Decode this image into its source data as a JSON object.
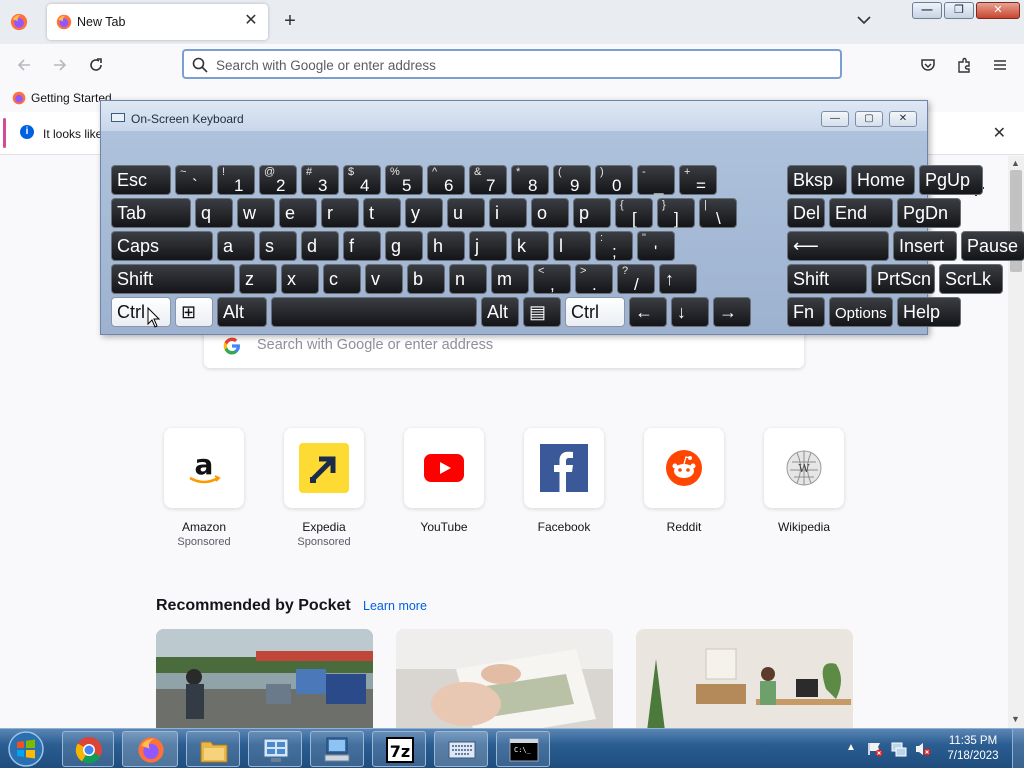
{
  "browser": {
    "tab_title": "New Tab",
    "urlbar_placeholder": "Search with Google or enter address",
    "bookmark_label": "Getting Started",
    "info_message": "It looks like"
  },
  "window_controls": {
    "minimize": "—",
    "restore": "❐",
    "close": "✕"
  },
  "osk": {
    "title": "On-Screen Keyboard",
    "rows": [
      [
        {
          "label": "Esc",
          "name": "key-esc"
        },
        {
          "shift": "~",
          "main": "`",
          "name": "key-backtick"
        },
        {
          "shift": "!",
          "main": "1",
          "name": "key-1"
        },
        {
          "shift": "@",
          "main": "2",
          "name": "key-2"
        },
        {
          "shift": "#",
          "main": "3",
          "name": "key-3"
        },
        {
          "shift": "$",
          "main": "4",
          "name": "key-4"
        },
        {
          "shift": "%",
          "main": "5",
          "name": "key-5"
        },
        {
          "shift": "^",
          "main": "6",
          "name": "key-6"
        },
        {
          "shift": "&",
          "main": "7",
          "name": "key-7"
        },
        {
          "shift": "*",
          "main": "8",
          "name": "key-8"
        },
        {
          "shift": "(",
          "main": "9",
          "name": "key-9"
        },
        {
          "shift": ")",
          "main": "0",
          "name": "key-0"
        },
        {
          "shift": "-",
          "main": "_",
          "name": "key-minus"
        },
        {
          "shift": "+",
          "main": "=",
          "name": "key-equals"
        },
        {
          "label": "Bksp",
          "name": "key-backspace"
        },
        {
          "label": "Home",
          "name": "key-home"
        },
        {
          "label": "PgUp",
          "name": "key-pgup"
        }
      ],
      [
        {
          "label": "Tab",
          "name": "key-tab"
        },
        {
          "label": "q",
          "name": "key-q"
        },
        {
          "label": "w",
          "name": "key-w"
        },
        {
          "label": "e",
          "name": "key-e"
        },
        {
          "label": "r",
          "name": "key-r"
        },
        {
          "label": "t",
          "name": "key-t"
        },
        {
          "label": "y",
          "name": "key-y"
        },
        {
          "label": "u",
          "name": "key-u"
        },
        {
          "label": "i",
          "name": "key-i"
        },
        {
          "label": "o",
          "name": "key-o"
        },
        {
          "label": "p",
          "name": "key-p"
        },
        {
          "shift": "{",
          "main": "[",
          "name": "key-lbracket"
        },
        {
          "shift": "}",
          "main": "]",
          "name": "key-rbracket"
        },
        {
          "shift": "|",
          "main": "\\",
          "name": "key-backslash"
        },
        {
          "label": "Del",
          "name": "key-del"
        },
        {
          "label": "End",
          "name": "key-end"
        },
        {
          "label": "PgDn",
          "name": "key-pgdn"
        }
      ],
      [
        {
          "label": "Caps",
          "name": "key-caps"
        },
        {
          "label": "a",
          "name": "key-a"
        },
        {
          "label": "s",
          "name": "key-s"
        },
        {
          "label": "d",
          "name": "key-d"
        },
        {
          "label": "f",
          "name": "key-f"
        },
        {
          "label": "g",
          "name": "key-g"
        },
        {
          "label": "h",
          "name": "key-h"
        },
        {
          "label": "j",
          "name": "key-j"
        },
        {
          "label": "k",
          "name": "key-k"
        },
        {
          "label": "l",
          "name": "key-l"
        },
        {
          "shift": ":",
          "main": ";",
          "name": "key-semicolon"
        },
        {
          "shift": "\"",
          "main": "'",
          "name": "key-quote"
        },
        {
          "label": "⟵",
          "name": "key-enter"
        },
        {
          "label": "Insert",
          "name": "key-insert"
        },
        {
          "label": "Pause",
          "name": "key-pause"
        }
      ],
      [
        {
          "label": "Shift",
          "name": "key-shift-left"
        },
        {
          "label": "z",
          "name": "key-z"
        },
        {
          "label": "x",
          "name": "key-x"
        },
        {
          "label": "c",
          "name": "key-c"
        },
        {
          "label": "v",
          "name": "key-v"
        },
        {
          "label": "b",
          "name": "key-b"
        },
        {
          "label": "n",
          "name": "key-n"
        },
        {
          "label": "m",
          "name": "key-m"
        },
        {
          "shift": "<",
          "main": ",",
          "name": "key-comma"
        },
        {
          "shift": ">",
          "main": ".",
          "name": "key-period"
        },
        {
          "shift": "?",
          "main": "/",
          "name": "key-slash"
        },
        {
          "label": "↑",
          "name": "key-up"
        },
        {
          "label": "Shift",
          "name": "key-shift-right"
        },
        {
          "label": "PrtScn",
          "name": "key-prtscn"
        },
        {
          "label": "ScrLk",
          "name": "key-scrlk"
        }
      ],
      [
        {
          "label": "Ctrl",
          "name": "key-ctrl-left",
          "active": true
        },
        {
          "label": "⊞",
          "name": "key-windows",
          "active": true
        },
        {
          "label": "Alt",
          "name": "key-alt-left"
        },
        {
          "label": "",
          "name": "key-space"
        },
        {
          "label": "Alt",
          "name": "key-alt-right"
        },
        {
          "label": "▤",
          "name": "key-menu"
        },
        {
          "label": "Ctrl",
          "name": "key-ctrl-right",
          "active": true
        },
        {
          "label": "←",
          "name": "key-left"
        },
        {
          "label": "↓",
          "name": "key-down"
        },
        {
          "label": "→",
          "name": "key-right"
        },
        {
          "label": "Fn",
          "name": "key-fn"
        },
        {
          "label": "Options",
          "name": "key-options"
        },
        {
          "label": "Help",
          "name": "key-help"
        }
      ]
    ]
  },
  "newtab": {
    "search_placeholder": "Search with Google or enter address",
    "shortcuts": [
      {
        "name": "Amazon",
        "sponsored": "Sponsored",
        "icon": "amazon-icon"
      },
      {
        "name": "Expedia",
        "sponsored": "Sponsored",
        "icon": "expedia-icon"
      },
      {
        "name": "YouTube",
        "sponsored": "",
        "icon": "youtube-icon"
      },
      {
        "name": "Facebook",
        "sponsored": "",
        "icon": "facebook-icon"
      },
      {
        "name": "Reddit",
        "sponsored": "",
        "icon": "reddit-icon"
      },
      {
        "name": "Wikipedia",
        "sponsored": "",
        "icon": "wikipedia-icon"
      }
    ],
    "pocket": {
      "title": "Recommended by Pocket",
      "learn_more": "Learn more"
    }
  },
  "taskbar": {
    "time": "11:35 PM",
    "date": "7/18/2023",
    "apps": [
      "chrome-icon",
      "firefox-icon",
      "file-explorer-icon",
      "control-panel-icon",
      "computer-icon",
      "7zip-icon",
      "on-screen-keyboard-icon",
      "command-prompt-icon"
    ]
  },
  "colors": {
    "accent": "#0061e0",
    "taskbar": "#2b5d92"
  }
}
